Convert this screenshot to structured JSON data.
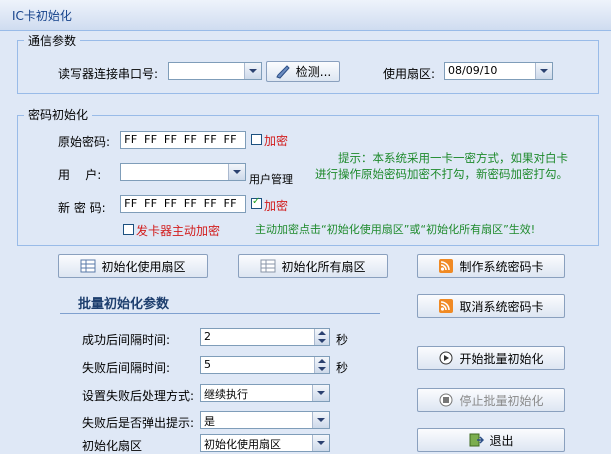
{
  "window": {
    "title": "IC卡初始化"
  },
  "comm": {
    "legend": "通信参数",
    "port_label": "读写器连接串口号:",
    "port_value": "",
    "detect_button": "检测...",
    "sector_label": "使用扇区:",
    "sector_value": "08/09/10"
  },
  "pwd": {
    "legend": "密码初始化",
    "orig_label": "原始密码:",
    "orig_value": "FF FF FF FF FF FF",
    "orig_encrypt": "加密",
    "user_label": "用    户:",
    "user_value": "",
    "user_mgmt": "用户管理",
    "new_label": "新 密 码:",
    "new_value": "FF FF FF FF FF FF",
    "new_encrypt": "加密",
    "reader_encrypt": "发卡器主动加密",
    "hint1": "提示：本系统采用一卡一密方式，如果对白卡",
    "hint2": "进行操作原始密码加密不打勾，新密码加密打勾。",
    "hint3": "主动加密点击“初始化使用扇区”或“初始化所有扇区”生效!"
  },
  "buttons": {
    "init_used": "初始化使用扇区",
    "init_all": "初始化所有扇区",
    "make_card": "制作系统密码卡",
    "cancel_card": "取消系统密码卡",
    "start_batch": "开始批量初始化",
    "stop_batch": "停止批量初始化",
    "exit": "退出"
  },
  "batch": {
    "title": "批量初始化参数",
    "success_label": "成功后间隔时间:",
    "success_value": "2",
    "success_unit": "秒",
    "fail_label": "失败后间隔时间:",
    "fail_value": "5",
    "fail_unit": "秒",
    "fail_action_label": "设置失败后处理方式:",
    "fail_action_value": "继续执行",
    "popup_label": "失败后是否弹出提示:",
    "popup_value": "是",
    "order_label": "初始化扇区",
    "order_value": "初始化使用扇区"
  },
  "colors": {
    "accent": "#15428b",
    "red": "#d21c1c",
    "green": "#1e8a2c"
  }
}
